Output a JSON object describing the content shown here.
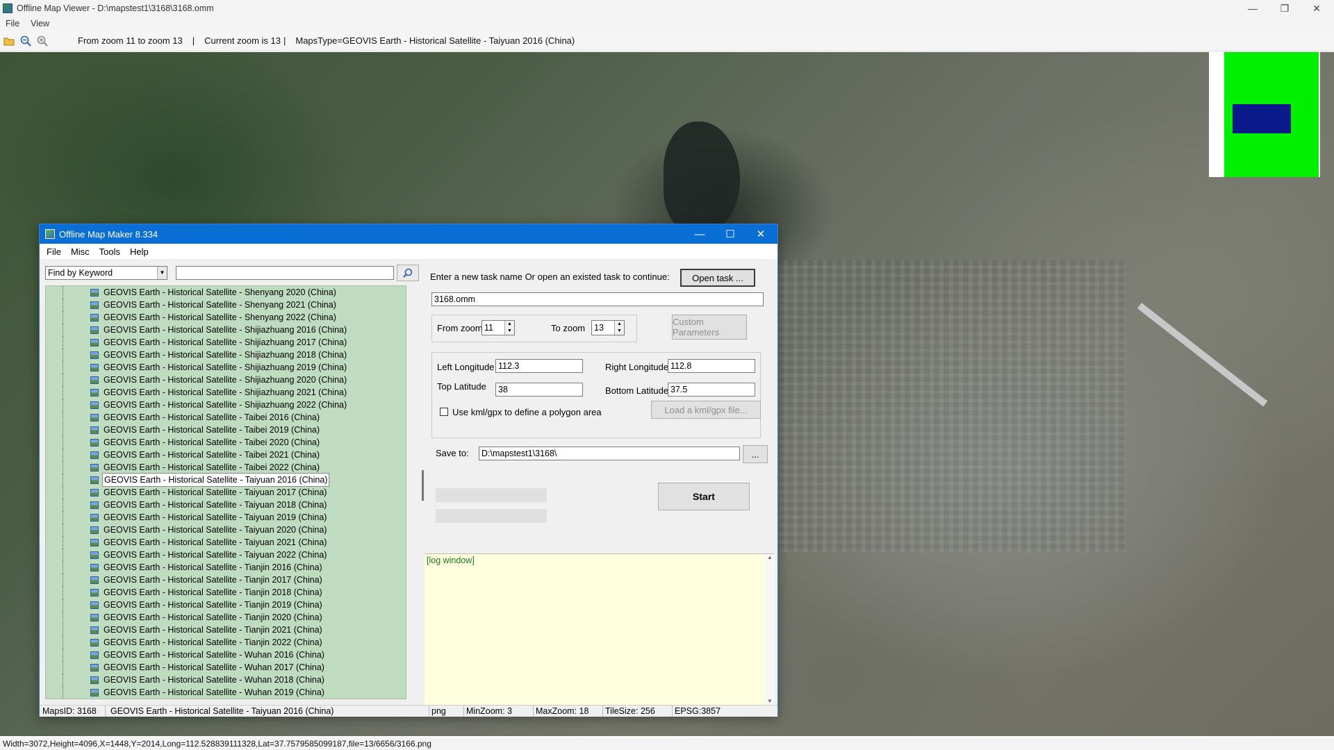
{
  "window": {
    "title": "Offline Map Viewer - D:\\mapstest1\\3168\\3168.omm",
    "controls": {
      "minimize": "—",
      "restore": "❐",
      "close": "✕"
    }
  },
  "menubar": [
    "File",
    "View"
  ],
  "toolbar": {
    "icons": [
      "folder-open-icon",
      "zoom-out-icon",
      "zoom-in-icon"
    ],
    "zoom_range": "From zoom 11 to zoom 13",
    "separator1": "|",
    "current_zoom": "Current zoom is 13",
    "separator2": "|",
    "maps_type": "MapsType=GEOVIS Earth - Historical Satellite - Taiyuan 2016 (China)"
  },
  "statusbar": "Width=3072,Height=4096,X=1448,Y=2014,Long=112.528839111328,Lat=37.7579585099187,file=13/6656/3166.png",
  "minimap": {
    "colors": {
      "background": "#00f000",
      "viewport": "#0a1a8a"
    }
  },
  "dialog": {
    "title": "Offline Map Maker 8.334",
    "controls": {
      "minimize": "—",
      "maximize": "☐",
      "close": "✕"
    },
    "menu": [
      "File",
      "Misc",
      "Tools",
      "Help"
    ],
    "search": {
      "mode": "Find by Keyword",
      "keyword": "",
      "button_icon": "search-icon"
    },
    "tree": {
      "selected_index": 15,
      "items": [
        "GEOVIS Earth - Historical Satellite - Shenyang 2020 (China)",
        "GEOVIS Earth - Historical Satellite - Shenyang 2021 (China)",
        "GEOVIS Earth - Historical Satellite - Shenyang 2022 (China)",
        "GEOVIS Earth - Historical Satellite - Shijiazhuang 2016 (China)",
        "GEOVIS Earth - Historical Satellite - Shijiazhuang 2017 (China)",
        "GEOVIS Earth - Historical Satellite - Shijiazhuang 2018 (China)",
        "GEOVIS Earth - Historical Satellite - Shijiazhuang 2019 (China)",
        "GEOVIS Earth - Historical Satellite - Shijiazhuang 2020 (China)",
        "GEOVIS Earth - Historical Satellite - Shijiazhuang 2021 (China)",
        "GEOVIS Earth - Historical Satellite - Shijiazhuang 2022 (China)",
        "GEOVIS Earth - Historical Satellite - Taibei 2016 (China)",
        "GEOVIS Earth - Historical Satellite - Taibei 2019 (China)",
        "GEOVIS Earth - Historical Satellite - Taibei 2020 (China)",
        "GEOVIS Earth - Historical Satellite - Taibei 2021 (China)",
        "GEOVIS Earth - Historical Satellite - Taibei 2022 (China)",
        "GEOVIS Earth - Historical Satellite - Taiyuan 2016 (China)",
        "GEOVIS Earth - Historical Satellite - Taiyuan 2017 (China)",
        "GEOVIS Earth - Historical Satellite - Taiyuan 2018 (China)",
        "GEOVIS Earth - Historical Satellite - Taiyuan 2019 (China)",
        "GEOVIS Earth - Historical Satellite - Taiyuan 2020 (China)",
        "GEOVIS Earth - Historical Satellite - Taiyuan 2021 (China)",
        "GEOVIS Earth - Historical Satellite - Taiyuan 2022 (China)",
        "GEOVIS Earth - Historical Satellite - Tianjin 2016 (China)",
        "GEOVIS Earth - Historical Satellite - Tianjin 2017 (China)",
        "GEOVIS Earth - Historical Satellite - Tianjin 2018 (China)",
        "GEOVIS Earth - Historical Satellite - Tianjin 2019 (China)",
        "GEOVIS Earth - Historical Satellite - Tianjin 2020 (China)",
        "GEOVIS Earth - Historical Satellite - Tianjin 2021 (China)",
        "GEOVIS Earth - Historical Satellite - Tianjin 2022 (China)",
        "GEOVIS Earth - Historical Satellite - Wuhan 2016 (China)",
        "GEOVIS Earth - Historical Satellite - Wuhan 2017 (China)",
        "GEOVIS Earth - Historical Satellite - Wuhan 2018 (China)",
        "GEOVIS Earth - Historical Satellite - Wuhan 2019 (China)"
      ]
    },
    "task": {
      "prompt": "Enter a new task name Or open an existed task to continue:",
      "open_button": "Open task ...",
      "name": "3168.omm"
    },
    "zoom": {
      "from_label": "From zoom",
      "from_value": "11",
      "to_label": "To zoom",
      "to_value": "13",
      "custom_button": "Custom Parameters"
    },
    "bounds": {
      "left_lon_label": "Left Longitude",
      "left_lon": "112.3",
      "right_lon_label": "Right Longitude",
      "right_lon": "112.8",
      "top_lat_label": "Top Latitude",
      "top_lat": "38",
      "bottom_lat_label": "Bottom Latitude",
      "bottom_lat": "37.5",
      "kml_label": "Use kml/gpx to define a polygon area",
      "kml_checked": false,
      "load_kml_button": "Load a kml/gpx file..."
    },
    "save": {
      "label": "Save to:",
      "path": "D:\\mapstest1\\3168\\",
      "browse_button": "..."
    },
    "start_button": "Start",
    "progress": [
      0,
      0
    ],
    "log": "[log window]",
    "status": {
      "maps_id": "MapsID: 3168",
      "map_name": "GEOVIS Earth - Historical Satellite - Taiyuan 2016 (China)",
      "format": "png",
      "min_zoom": "MinZoom: 3",
      "max_zoom": "MaxZoom: 18",
      "tile_size": "TileSize: 256",
      "epsg": "EPSG:3857"
    }
  }
}
